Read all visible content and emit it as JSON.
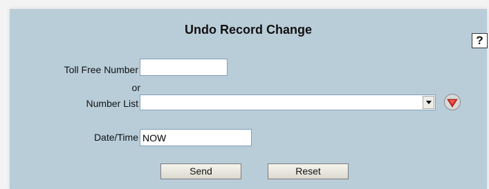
{
  "form": {
    "title": "Undo Record Change",
    "help_label": "?",
    "toll_free_label": "Toll Free Number",
    "toll_free_value": "",
    "or_label": "or",
    "number_list_label": "Number List",
    "number_list_selected": "",
    "datetime_label": "Date/Time",
    "datetime_value": "NOW",
    "send_label": "Send",
    "reset_label": "Reset"
  },
  "icons": {
    "select_arrow": "chevron-down-icon",
    "dropdown_action": "red-down-arrow-icon"
  },
  "colors": {
    "panel_bg": "#b9cdd9",
    "accent_red": "#d92b20"
  }
}
